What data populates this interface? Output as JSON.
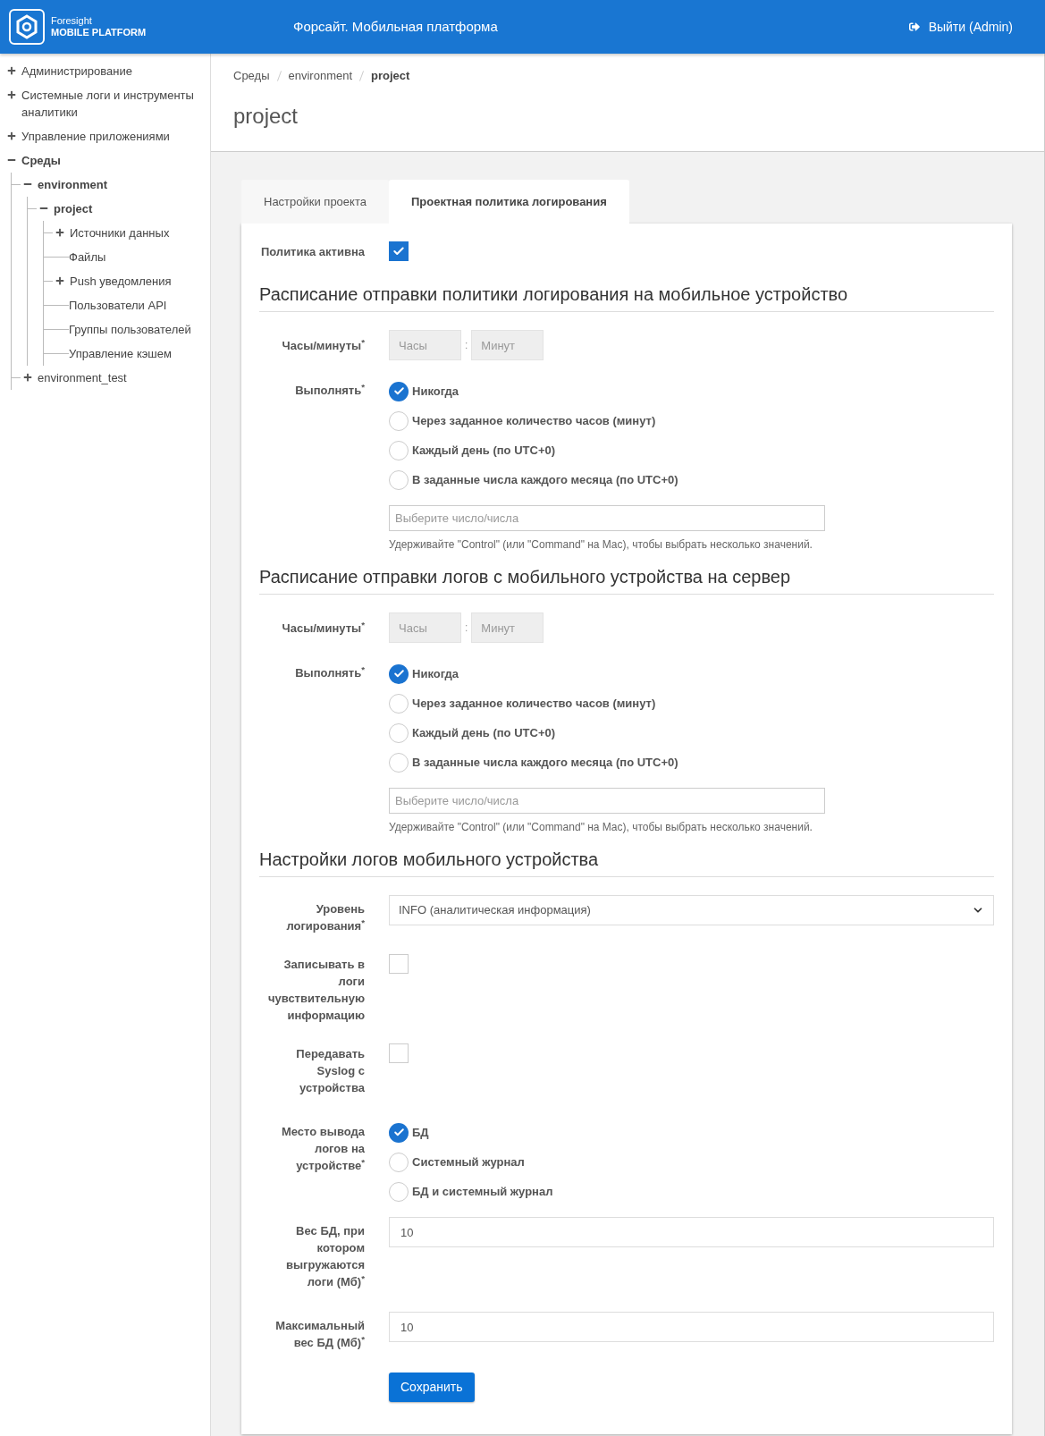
{
  "header": {
    "logo_line1": "Foresight",
    "logo_line2": "MOBILE PLATFORM",
    "title": "Форсайт. Мобильная платформа",
    "logout": "Выйти (Admin)"
  },
  "sidebar": {
    "items": [
      {
        "label": "Администрирование",
        "kind": "folder",
        "expanded": false
      },
      {
        "label": "Системные логи и инструменты аналитики",
        "kind": "folder",
        "expanded": false
      },
      {
        "label": "Управление приложениями",
        "kind": "folder",
        "expanded": false
      },
      {
        "label": "Среды",
        "kind": "folder",
        "expanded": true,
        "children": [
          {
            "label": "environment",
            "kind": "folder",
            "expanded": true,
            "children": [
              {
                "label": "project",
                "kind": "folder",
                "expanded": true,
                "children": [
                  {
                    "label": "Источники данных",
                    "kind": "folder",
                    "expanded": false
                  },
                  {
                    "label": "Файлы",
                    "kind": "leaf"
                  },
                  {
                    "label": "Push уведомления",
                    "kind": "folder",
                    "expanded": false
                  },
                  {
                    "label": "Пользователи API",
                    "kind": "leaf"
                  },
                  {
                    "label": "Группы пользователей",
                    "kind": "leaf"
                  },
                  {
                    "label": "Управление кэшем",
                    "kind": "leaf"
                  }
                ]
              }
            ]
          },
          {
            "label": "environment_test",
            "kind": "folder",
            "expanded": false
          }
        ]
      }
    ]
  },
  "breadcrumbs": [
    {
      "label": "Среды",
      "current": false
    },
    {
      "label": "environment",
      "current": false
    },
    {
      "label": "project",
      "current": true
    }
  ],
  "page_title": "project",
  "tabs": [
    {
      "label": "Настройки проекта",
      "selected": false
    },
    {
      "label": "Проектная политика логирования",
      "selected": true
    }
  ],
  "form": {
    "rows": [
      {
        "kind": "checkbox",
        "label": "Политика активна",
        "checked": true
      },
      {
        "kind": "heading",
        "title": "Расписание отправки политики логирования на мобильное устройство"
      },
      {
        "kind": "time",
        "label": "Часы/минуты$^{*}$",
        "hours_placeholder": "Часы",
        "separator": ":",
        "minutes_placeholder": "Минут",
        "disabled": true
      },
      {
        "kind": "radio",
        "label": "Выполнять$^{*}$",
        "options": [
          {
            "label": "Никогда",
            "selected": true
          },
          {
            "label": "Через заданное количество часов (минут)",
            "selected": false
          },
          {
            "label": "Каждый день (по UTC+0)",
            "selected": false
          },
          {
            "label": "В заданные числа каждого месяца (по UTC+0)",
            "selected": false
          }
        ]
      },
      {
        "kind": "multiselect",
        "placeholder": "Выберите число/числа",
        "help": "Удерживайте \"Control\" (или \"Command\" на Mac), чтобы выбрать несколько значений."
      },
      {
        "kind": "heading",
        "title": "Расписание отправки логов с мобильного устройства на сервер"
      },
      {
        "kind": "time",
        "label": "Часы/минуты$^{*}$",
        "hours_placeholder": "Часы",
        "separator": ":",
        "minutes_placeholder": "Минут",
        "disabled": true
      },
      {
        "kind": "radio",
        "label": "Выполнять$^{*}$",
        "options": [
          {
            "label": "Никогда",
            "selected": true
          },
          {
            "label": "Через заданное количество часов (минут)",
            "selected": false
          },
          {
            "label": "Каждый день (по UTC+0)",
            "selected": false
          },
          {
            "label": "В заданные числа каждого месяца (по UTC+0)",
            "selected": false
          }
        ]
      },
      {
        "kind": "multiselect",
        "placeholder": "Выберите число/числа",
        "help": "Удерживайте \"Control\" (или \"Command\" на Mac), чтобы выбрать несколько значений."
      },
      {
        "kind": "heading",
        "title": "Настройки логов мобильного устройства"
      },
      {
        "kind": "select",
        "label": "Уровень логирования$^{*}$",
        "value": "INFO (аналитическая информация)"
      },
      {
        "kind": "checkbox",
        "label": "Записывать в логи чувствительную информацию",
        "checked": false
      },
      {
        "kind": "checkbox",
        "label": "Передавать Syslog с устройства",
        "checked": false
      },
      {
        "kind": "radio",
        "label": "Место вывода логов на устройстве$^{*}$",
        "options": [
          {
            "label": "БД",
            "selected": true
          },
          {
            "label": "Системный журнал",
            "selected": false
          },
          {
            "label": "БД и системный журнал",
            "selected": false
          }
        ]
      },
      {
        "kind": "text",
        "label": "Вес БД, при котором выгружаются логи (Мб)$^{*}$",
        "value": "10"
      },
      {
        "kind": "text",
        "label": "Максимальный вес БД (Мб)$^{*}$",
        "value": "10"
      }
    ],
    "save_button": "Сохранить"
  }
}
